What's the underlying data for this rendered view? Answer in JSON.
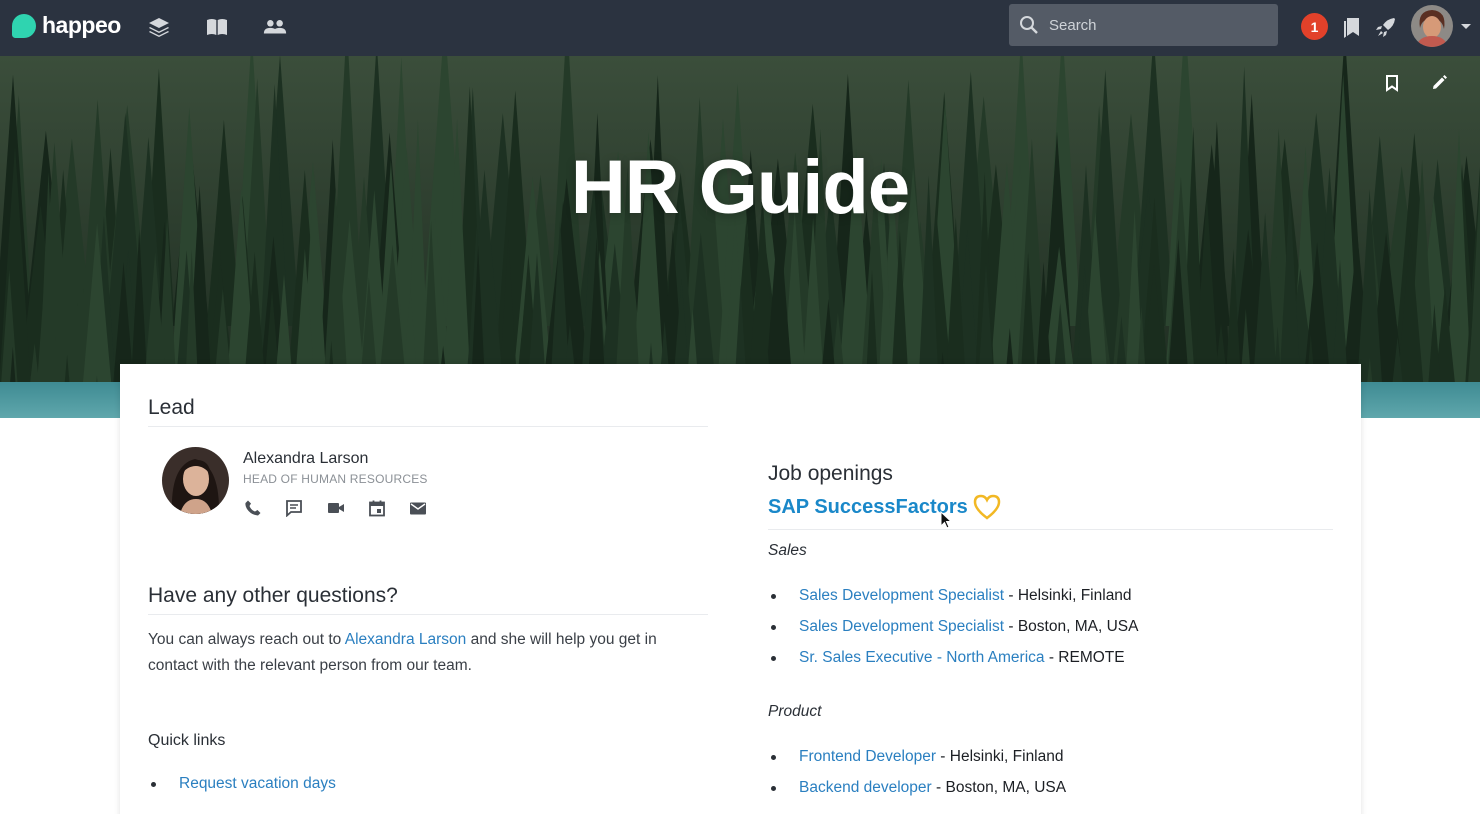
{
  "app": {
    "name": "happeo"
  },
  "topbar": {
    "nav_icons": [
      "layers-icon",
      "book-icon",
      "people-icon"
    ],
    "search": {
      "placeholder": "Search",
      "value": ""
    },
    "notification_count": "1",
    "right_icons": [
      "bookmarks-icon",
      "rocket-icon"
    ]
  },
  "hero": {
    "title": "HR Guide",
    "actions": [
      "bookmark-icon",
      "edit-icon"
    ]
  },
  "lead": {
    "heading": "Lead",
    "name": "Alexandra Larson",
    "role": "HEAD OF HUMAN RESOURCES",
    "contact_icons": [
      "phone-icon",
      "chat-icon",
      "video-icon",
      "calendar-icon",
      "email-icon"
    ]
  },
  "questions": {
    "heading": "Have any other questions?",
    "text_before": "You can always reach out to ",
    "link": "Alexandra Larson",
    "text_after": " and she will help you get in contact with the relevant person from our team."
  },
  "quick_links": {
    "heading": "Quick links",
    "items": [
      {
        "label": "Request vacation days"
      }
    ]
  },
  "jobs": {
    "heading": "Job openings",
    "provider": "SAP SuccessFactors",
    "categories": [
      {
        "name": "Sales",
        "items": [
          {
            "title": "Sales Development Specialist",
            "location": " - Helsinki, Finland"
          },
          {
            "title": "Sales Development Specialist",
            "location": " - Boston, MA, USA"
          },
          {
            "title": "Sr. Sales Executive - North America",
            "location": " - REMOTE"
          }
        ]
      },
      {
        "name": "Product",
        "items": [
          {
            "title": "Frontend Developer",
            "location": " - Helsinki, Finland"
          },
          {
            "title": "Backend developer",
            "location": " - Boston, MA, USA"
          }
        ]
      }
    ]
  },
  "colors": {
    "topbar": "#2b3340",
    "brand": "#2fd4b0",
    "link": "#2a7fc0",
    "provider_link": "#1a88c9",
    "notification": "#e2412a",
    "heart": "#f2b824"
  }
}
